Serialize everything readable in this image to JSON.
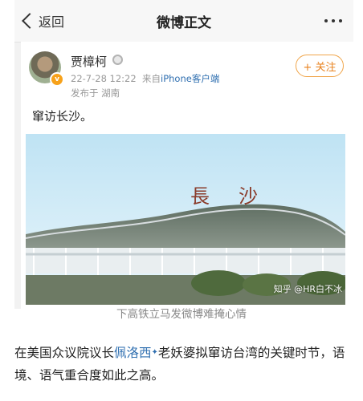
{
  "navbar": {
    "back_label": "返回",
    "title": "微博正文"
  },
  "post": {
    "username": "贾樟柯",
    "date": "22-7-28 12:22",
    "source_prefix": "来自",
    "source_name": "iPhone客户端",
    "location": "发布于 湖南",
    "follow_label": "+ 关注",
    "text": "窜访长沙。",
    "photo_watermark": "知乎 @HR白不冰",
    "photo_sign": "長沙"
  },
  "article": {
    "caption": "下高铁立马发微博难掩心情",
    "para_before": "在美国众议院议长",
    "link_name": "佩洛西",
    "para_after": "老妖婆拟窜访台湾的关键时节，语境、语气重合度如此之高。"
  },
  "colors": {
    "accent": "#e8811c",
    "link": "#2f6fb0",
    "muted": "#999999"
  }
}
